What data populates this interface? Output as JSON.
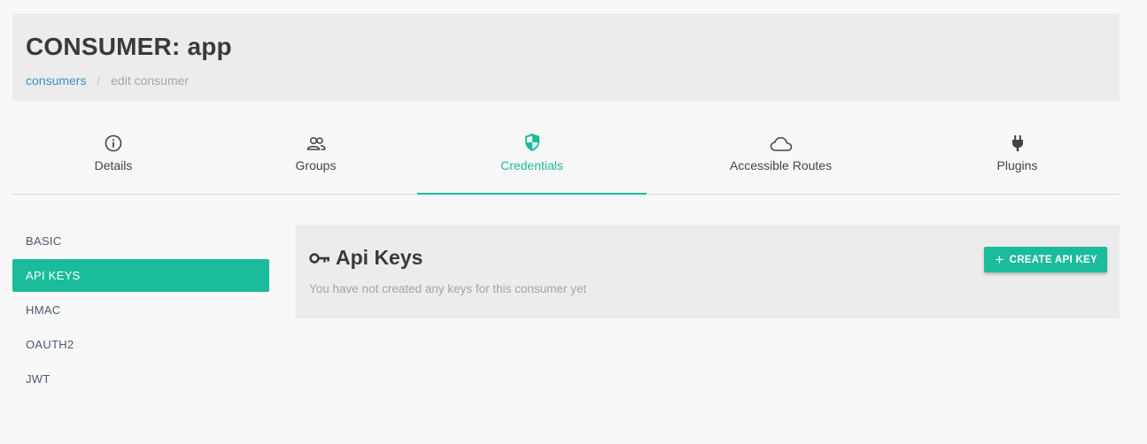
{
  "header": {
    "title": "CONSUMER: app",
    "breadcrumb": {
      "link": "consumers",
      "separator": "/",
      "current": "edit consumer"
    }
  },
  "tabs": [
    {
      "label": "Details",
      "icon": "info-circle-icon",
      "active": false
    },
    {
      "label": "Groups",
      "icon": "users-icon",
      "active": false
    },
    {
      "label": "Credentials",
      "icon": "shield-icon",
      "active": true
    },
    {
      "label": "Accessible Routes",
      "icon": "cloud-icon",
      "active": false
    },
    {
      "label": "Plugins",
      "icon": "plug-icon",
      "active": false
    }
  ],
  "sidenav": {
    "items": [
      {
        "label": "BASIC",
        "active": false
      },
      {
        "label": "API KEYS",
        "active": true
      },
      {
        "label": "HMAC",
        "active": false
      },
      {
        "label": "OAUTH2",
        "active": false
      },
      {
        "label": "JWT",
        "active": false
      }
    ]
  },
  "panel": {
    "title": "Api Keys",
    "title_icon": "key-icon",
    "empty_text": "You have not created any keys for this consumer yet",
    "create_button": "CREATE API KEY"
  },
  "colors": {
    "accent": "#1abc9c",
    "link": "#3b8fc8",
    "header_bg": "#ececec",
    "page_bg": "#f8f8f8"
  }
}
